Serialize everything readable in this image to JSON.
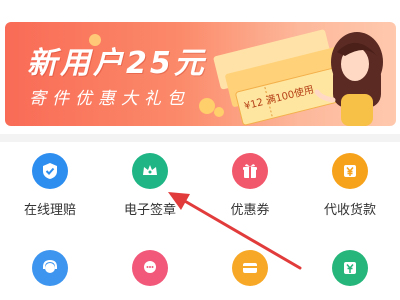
{
  "banner": {
    "title": "新用户25元",
    "subtitle": "寄件优惠大礼包",
    "ticket_text": "¥12 满100使用",
    "colors": {
      "start": "#f96b56",
      "end": "#ffc9ae"
    }
  },
  "services": [
    {
      "label": "在线理赔",
      "icon": "shield-check-icon",
      "color": "#2d8ef0"
    },
    {
      "label": "电子签章",
      "icon": "crown-icon",
      "color": "#1fb585"
    },
    {
      "label": "优惠券",
      "icon": "gift-icon",
      "color": "#f2586b"
    },
    {
      "label": "代收货款",
      "icon": "yuan-icon",
      "color": "#f7a21b"
    },
    {
      "label": "",
      "icon": "headset-icon",
      "color": "#3d95ef"
    },
    {
      "label": "",
      "icon": "chat-icon",
      "color": "#f2587a"
    },
    {
      "label": "",
      "icon": "card-icon",
      "color": "#f7a826"
    },
    {
      "label": "",
      "icon": "yuan-note-icon",
      "color": "#26b57a"
    }
  ]
}
